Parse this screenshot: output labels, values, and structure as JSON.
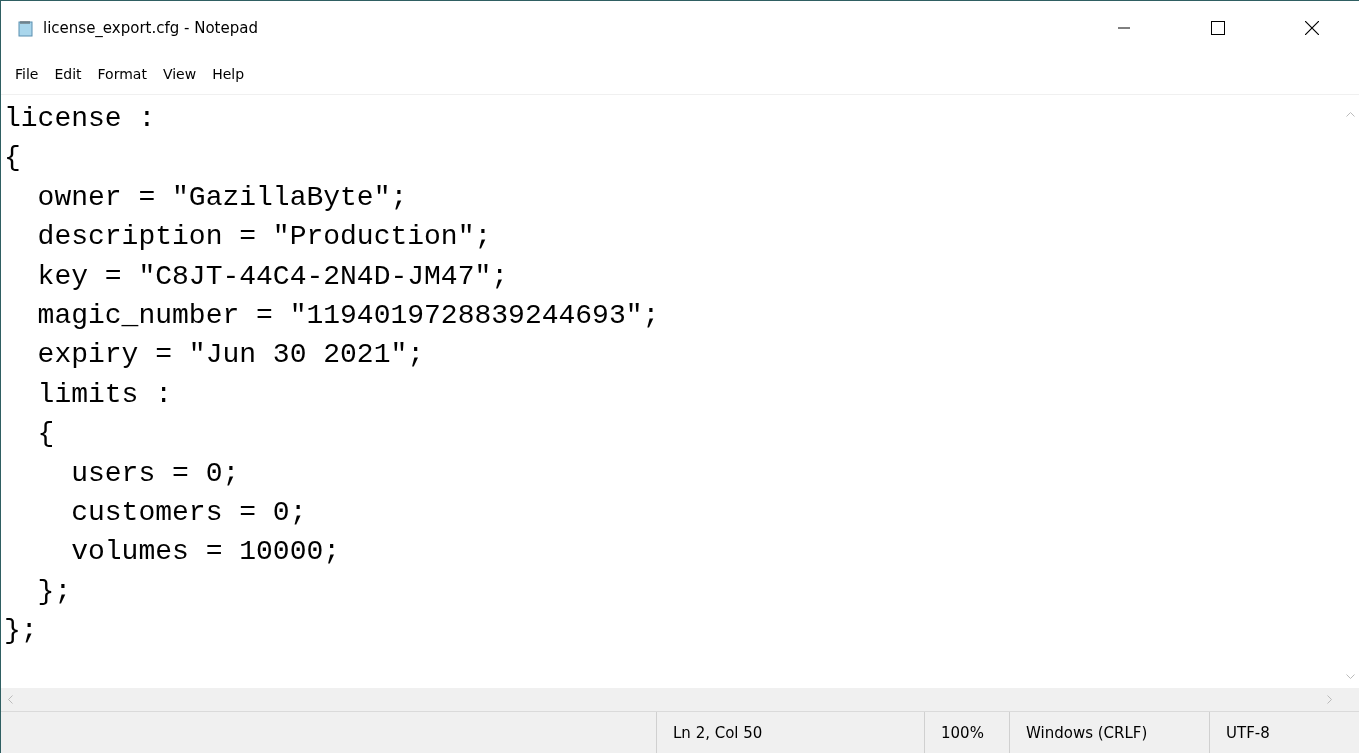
{
  "window": {
    "title": "license_export.cfg - Notepad"
  },
  "menu": [
    "File",
    "Edit",
    "Format",
    "View",
    "Help"
  ],
  "editor": {
    "lines": [
      "license :",
      "{",
      "  owner = \"GazillaByte\";",
      "  description = \"Production\";",
      "  key = \"C8JT-44C4-2N4D-JM47\";",
      "  magic_number = \"1194019728839244693\";",
      "  expiry = \"Jun 30 2021\";",
      "  limits :",
      "  {",
      "    users = 0;",
      "    customers = 0;",
      "    volumes = 10000;",
      "  };",
      "};"
    ]
  },
  "status_bar": [
    "Ln 2, Col 50",
    "100%",
    "Windows (CRLF)",
    "UTF-8"
  ]
}
